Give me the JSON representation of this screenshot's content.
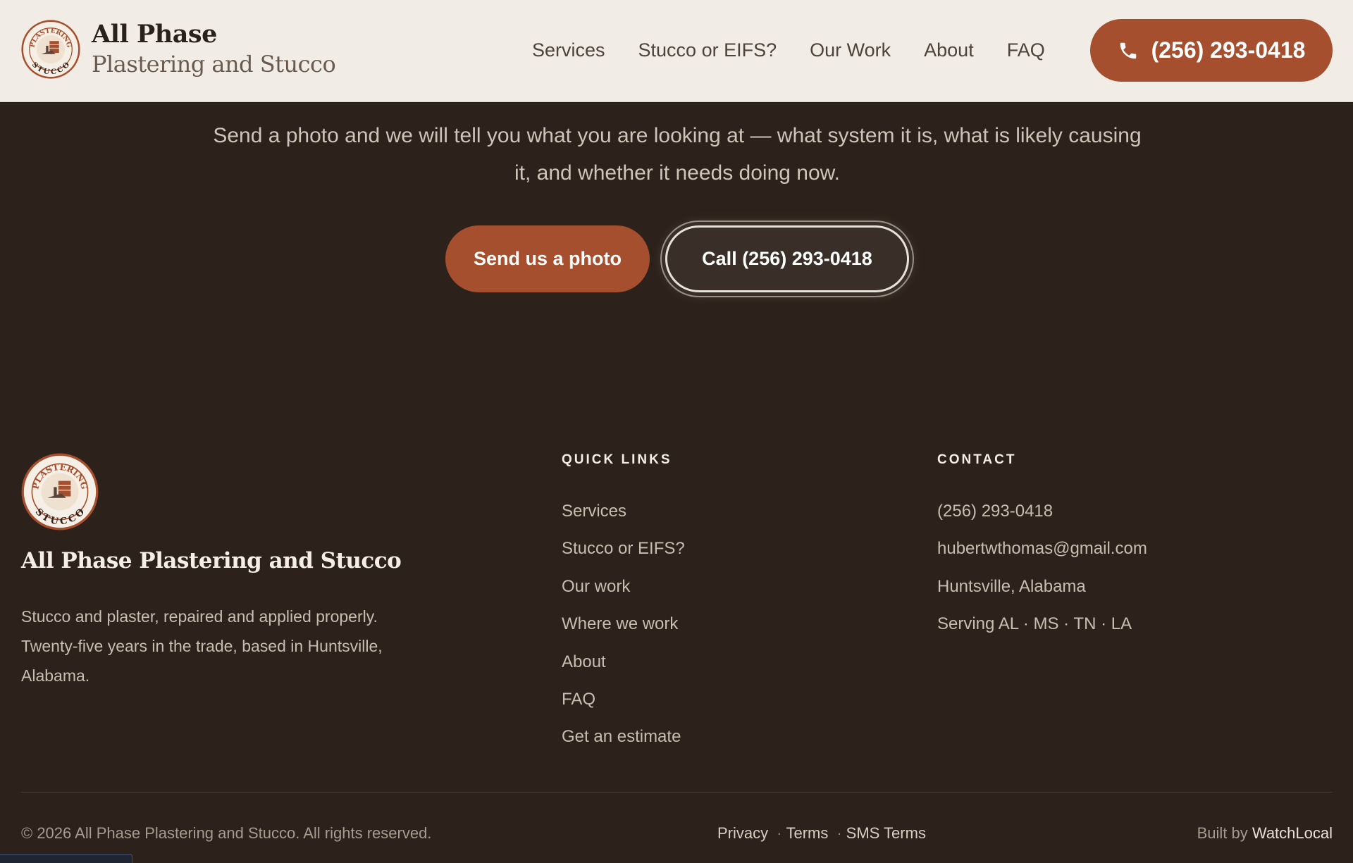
{
  "header": {
    "brand_line1": "All Phase",
    "brand_line2": "Plastering and Stucco",
    "logo_top_text": "PLASTERING",
    "logo_bottom_text": "STUCCO",
    "nav": [
      "Services",
      "Stucco or EIFS?",
      "Our Work",
      "About",
      "FAQ"
    ],
    "phone": "(256) 293-0418",
    "phone_icon": "phone-icon"
  },
  "cta": {
    "text": "Send a photo and we will tell you what you are looking at — what system it is, what is likely causing it, and whether it needs doing now.",
    "photo_button": "Send us a photo",
    "call_button": "Call (256) 293-0418"
  },
  "footer": {
    "name": "All Phase Plastering and Stucco",
    "description": "Stucco and plaster, repaired and applied properly. Twenty-five years in the trade, based in Huntsville, Alabama.",
    "quick_links_title": "QUICK LINKS",
    "quick_links": [
      "Services",
      "Stucco or EIFS?",
      "Our work",
      "Where we work",
      "About",
      "FAQ",
      "Get an estimate"
    ],
    "contact_title": "CONTACT",
    "contact": [
      "(256) 293-0418",
      "hubertwthomas@gmail.com",
      "Huntsville, Alabama",
      "Serving AL · MS · TN · LA"
    ],
    "copyright": "© 2026 All Phase Plastering and Stucco. All rights reserved.",
    "legal": [
      "Privacy",
      "Terms",
      "SMS Terms"
    ],
    "legal_sep": "·",
    "built_by_prefix": "Built by",
    "built_by_name": "WatchLocal"
  },
  "colors": {
    "accent": "#a64f2e",
    "header_bg": "#f1ede6",
    "page_bg": "#2d221b"
  }
}
